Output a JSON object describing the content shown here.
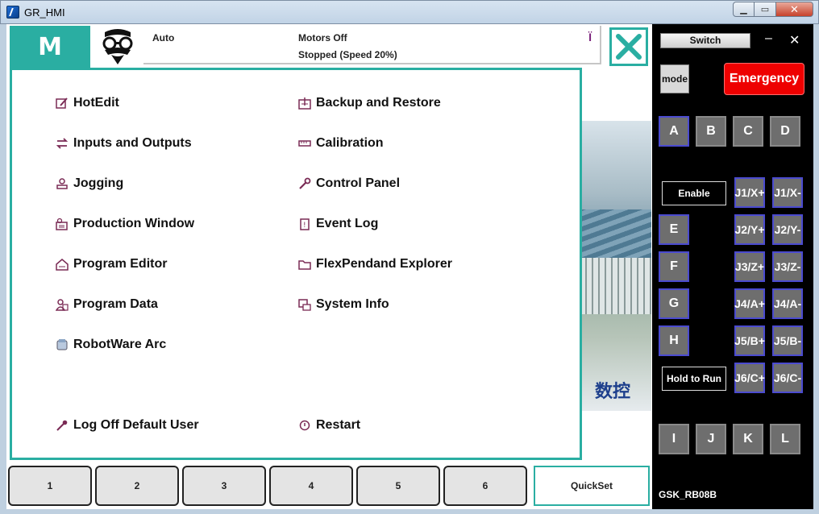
{
  "window": {
    "title": "GR_HMI",
    "min_icon": "minimize-icon",
    "max_icon": "maximize-icon",
    "close_icon": "close-icon"
  },
  "header": {
    "logo_letter": "M",
    "mode_text": "Auto",
    "motors_text": "Motors Off",
    "speed_text": "Stopped (Speed 20%)",
    "status_icon": "Ї"
  },
  "menu": {
    "left": [
      {
        "label": "HotEdit",
        "icon": "hotedit-icon"
      },
      {
        "label": "Inputs and Outputs",
        "icon": "io-icon"
      },
      {
        "label": "Jogging",
        "icon": "jogging-icon"
      },
      {
        "label": "Production Window",
        "icon": "production-icon"
      },
      {
        "label": "Program Editor",
        "icon": "editor-icon"
      },
      {
        "label": "Program Data",
        "icon": "data-icon"
      },
      {
        "label": "RobotWare Arc",
        "icon": "arc-icon"
      }
    ],
    "right": [
      {
        "label": "Backup and Restore",
        "icon": "backup-icon"
      },
      {
        "label": "Calibration",
        "icon": "calibration-icon"
      },
      {
        "label": "Control Panel",
        "icon": "wrench-icon"
      },
      {
        "label": "Event Log",
        "icon": "eventlog-icon"
      },
      {
        "label": "FlexPendand Explorer",
        "icon": "folder-icon"
      },
      {
        "label": "System Info",
        "icon": "sysinfo-icon"
      }
    ],
    "logoff": "Log Off Default User",
    "restart": "Restart"
  },
  "background_text": "数控",
  "tabs": [
    "1",
    "2",
    "3",
    "4",
    "5",
    "6"
  ],
  "quickset": "QuickSet",
  "side": {
    "switch": "Switch",
    "min": "–",
    "close": "✕",
    "mode": "mode",
    "emergency": "Emergency",
    "keys_top": [
      "A",
      "B",
      "C",
      "D"
    ],
    "enable": "Enable",
    "keys_left": [
      "E",
      "F",
      "G",
      "H"
    ],
    "jog": [
      [
        "J1/X+",
        "J1/X-"
      ],
      [
        "J2/Y+",
        "J2/Y-"
      ],
      [
        "J3/Z+",
        "J3/Z-"
      ],
      [
        "J4/A+",
        "J4/A-"
      ],
      [
        "J5/B+",
        "J5/B-"
      ],
      [
        "J6/C+",
        "J6/C-"
      ]
    ],
    "hold": "Hold to Run",
    "keys_bottom": [
      "I",
      "J",
      "K",
      "L"
    ],
    "device": "GSK_RB08B"
  }
}
